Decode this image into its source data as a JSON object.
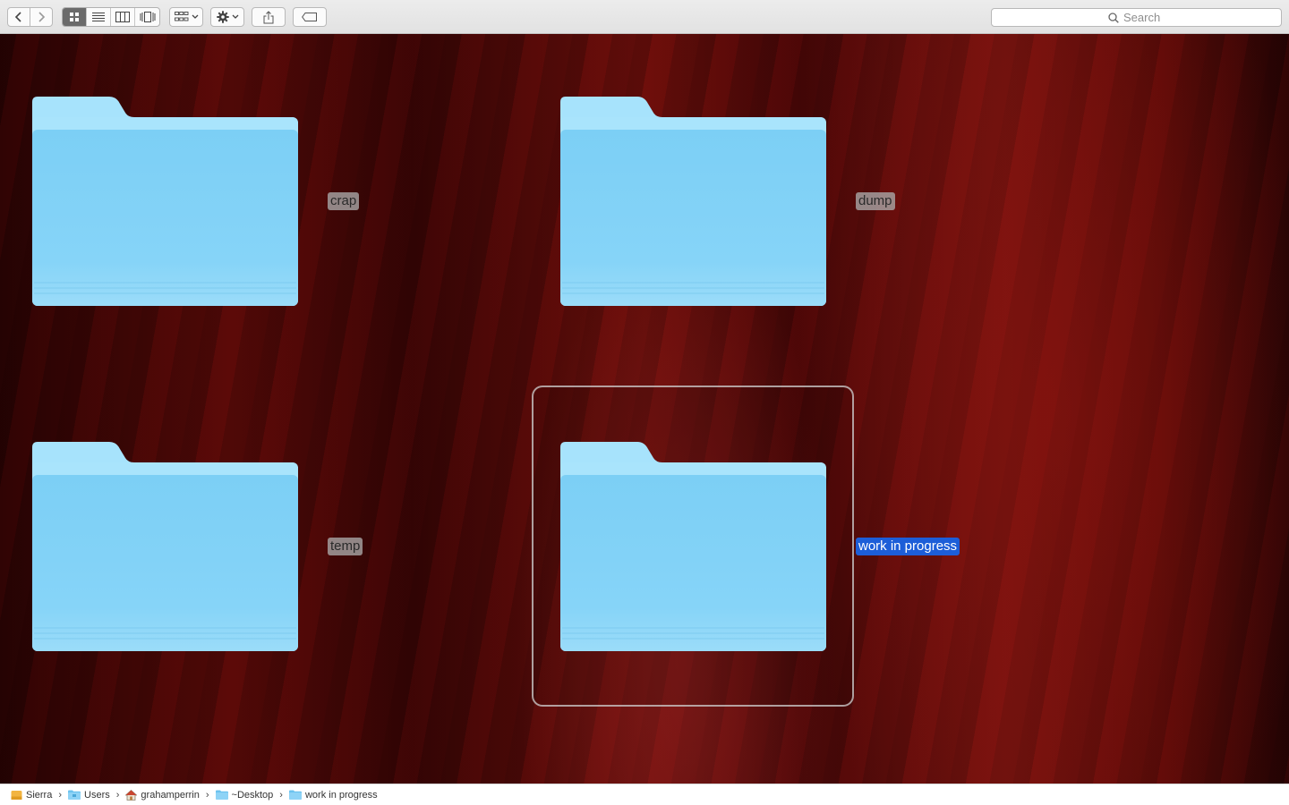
{
  "toolbar": {
    "back_icon": "chevron-left-icon",
    "forward_icon": "chevron-right-icon",
    "view_modes": [
      "icon-view",
      "list-view",
      "column-view",
      "cover-flow-view"
    ],
    "active_view": "icon-view",
    "arrange_icon": "arrange-grid-icon",
    "action_icon": "gear-icon",
    "share_icon": "share-icon",
    "tag_icon": "tag-icon",
    "search_placeholder": "Search"
  },
  "items": [
    {
      "name": "crap",
      "selected": false
    },
    {
      "name": "dump",
      "selected": false
    },
    {
      "name": "temp",
      "selected": false
    },
    {
      "name": "work in progress",
      "selected": true
    }
  ],
  "pathbar": {
    "crumbs": [
      {
        "label": "Sierra",
        "icon": "disk-icon"
      },
      {
        "label": "Users",
        "icon": "folder-icon"
      },
      {
        "label": "grahamperrin",
        "icon": "home-icon"
      },
      {
        "label": "~Desktop",
        "icon": "folder-icon"
      },
      {
        "label": "work in progress",
        "icon": "folder-icon"
      }
    ]
  },
  "colors": {
    "selection": "#1d5ed8",
    "folder_light": "#a6e2fb",
    "folder_body": "#7fd0f6"
  }
}
